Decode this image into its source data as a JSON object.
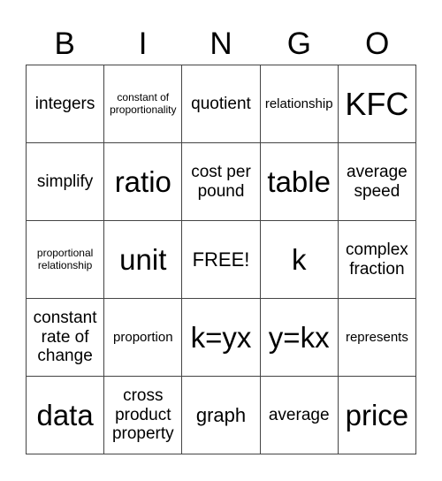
{
  "header": [
    "B",
    "I",
    "N",
    "G",
    "O"
  ],
  "cells": [
    {
      "text": "integers",
      "size": "md"
    },
    {
      "text": "constant of proportionality",
      "size": "xs"
    },
    {
      "text": "quotient",
      "size": "md"
    },
    {
      "text": "relationship",
      "size": "sm"
    },
    {
      "text": "KFC",
      "size": "xxl"
    },
    {
      "text": "simplify",
      "size": "md"
    },
    {
      "text": "ratio",
      "size": "xl"
    },
    {
      "text": "cost per pound",
      "size": "md"
    },
    {
      "text": "table",
      "size": "xl"
    },
    {
      "text": "average speed",
      "size": "md"
    },
    {
      "text": "proportional relationship",
      "size": "xs"
    },
    {
      "text": "unit",
      "size": "xl"
    },
    {
      "text": "FREE!",
      "size": "lg"
    },
    {
      "text": "k",
      "size": "xl"
    },
    {
      "text": "complex fraction",
      "size": "md"
    },
    {
      "text": "constant rate of change",
      "size": "md"
    },
    {
      "text": "proportion",
      "size": "sm"
    },
    {
      "text": "k=yx",
      "size": "xl"
    },
    {
      "text": "y=kx",
      "size": "xl"
    },
    {
      "text": "represents",
      "size": "sm"
    },
    {
      "text": "data",
      "size": "xl"
    },
    {
      "text": "cross product property",
      "size": "md"
    },
    {
      "text": "graph",
      "size": "lg"
    },
    {
      "text": "average",
      "size": "md"
    },
    {
      "text": "price",
      "size": "xl"
    }
  ]
}
